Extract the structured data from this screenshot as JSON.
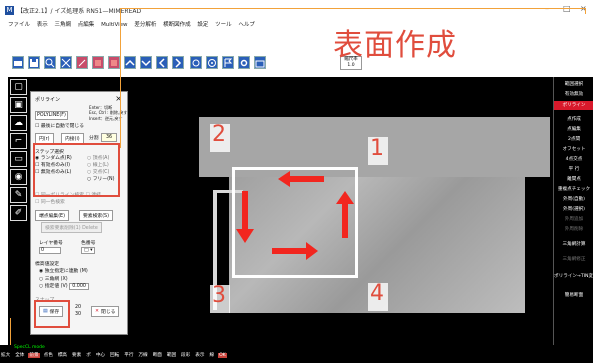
{
  "window": {
    "title": "【改正2.1】/ イズ処理系 RN51—MIMEREAD",
    "app_icon": "M"
  },
  "heading": "表面作成",
  "menu": [
    "ファイル",
    "表示",
    "三角網",
    "点編集",
    "MultiView",
    "差分解析",
    "横断図作成",
    "設定",
    "ツール",
    "ヘルプ"
  ],
  "toolbar": {
    "scale_label": "縮尺率",
    "scale_value": "1.0",
    "icons": [
      "open-folder-icon",
      "save-icon",
      "zoom-icon",
      "fit-icon",
      "pin-icon",
      "red-tool-icon",
      "red-tool2-icon",
      "arrow-up-icon",
      "arrow-down-icon",
      "arrow-left-icon",
      "arrow-right-icon",
      "rotate-icon",
      "target-icon",
      "flag-icon",
      "settings-icon",
      "export-icon"
    ]
  },
  "dialog": {
    "title": "ポリライン",
    "mode_label": "POLYLINE(F)",
    "enter_hint": "Enter：切断",
    "esc_hint": "Esc, Ctrl : 削除,戻す",
    "insert_hint": "Insert：逆元,戻す",
    "auto_close": "最後に自動で閉じる",
    "circle_btn": "円(r)",
    "inner_circle_btn": "内接(i)",
    "divide_label": "分割",
    "divide_value": "36",
    "step_group": "ステップ選択",
    "radio_random": "ランダム点(R)",
    "radio_a": "頂点(A)",
    "radio_valid_only": "有効点のみ(I)",
    "radio_b": "線上(L)",
    "radio_invalid_only": "無効点のみ(L)",
    "radio_c": "交点(C)",
    "radio_free": "フリー(N)",
    "check_polyline": "同一ポリライン検索",
    "check_connect": "連結",
    "check_same": "同一色検索",
    "btn_end_edit": "端点編集(E)",
    "btn_point_search": "要素検索(S)",
    "btn_delete": "検索要素削除(1) Delete",
    "layer_label": "レイヤ番号",
    "layer_value": "0",
    "color_label": "色番号",
    "color_value": "□",
    "elevation_group": "標高値設定",
    "elev_option1": "独立指定に連動 (M)",
    "elev_option2": "三角網 (X)",
    "elev_option3": "指定値 (V)",
    "elev_value": "0.000",
    "snap_label": "スナップ",
    "save_btn": "保存",
    "save_x": "20",
    "save_y": "30",
    "close_btn": "閉じる"
  },
  "corners": [
    "1",
    "2",
    "3",
    "4"
  ],
  "right_panel": [
    {
      "label": "範囲選択",
      "style": "normal"
    },
    {
      "label": "有効無効",
      "style": "normal"
    },
    {
      "label": "ポリライン",
      "style": "red"
    },
    {
      "label": "点作成",
      "style": "normal"
    },
    {
      "label": "点編集",
      "style": "normal"
    },
    {
      "label": "2点間",
      "style": "normal"
    },
    {
      "label": "オフセット",
      "style": "normal"
    },
    {
      "label": "4点交点",
      "style": "normal"
    },
    {
      "label": "平 行",
      "style": "normal"
    },
    {
      "label": "離間点",
      "style": "normal"
    },
    {
      "label": "重複点チェック",
      "style": "normal"
    },
    {
      "label": "外周(自動)",
      "style": "normal"
    },
    {
      "label": "外周(選択)",
      "style": "normal"
    },
    {
      "label": "外周追加",
      "style": "gray"
    },
    {
      "label": "外周削除",
      "style": "gray"
    },
    {
      "label": "三角網計算",
      "style": "normal"
    },
    {
      "label": "三角網修正",
      "style": "gray"
    },
    {
      "label": "ポリライン→TIN変換",
      "style": "normal"
    },
    {
      "label": "簡易断面",
      "style": "normal"
    }
  ],
  "status": {
    "snap_text": "SpecCL mode",
    "items": [
      "拡大",
      "全体",
      "前景",
      "点色",
      "標高",
      "要素",
      "ポ",
      "中心",
      "回転",
      "平行",
      "万線",
      "断面",
      "範囲",
      "段彩",
      "表示",
      "線",
      "OK"
    ]
  }
}
